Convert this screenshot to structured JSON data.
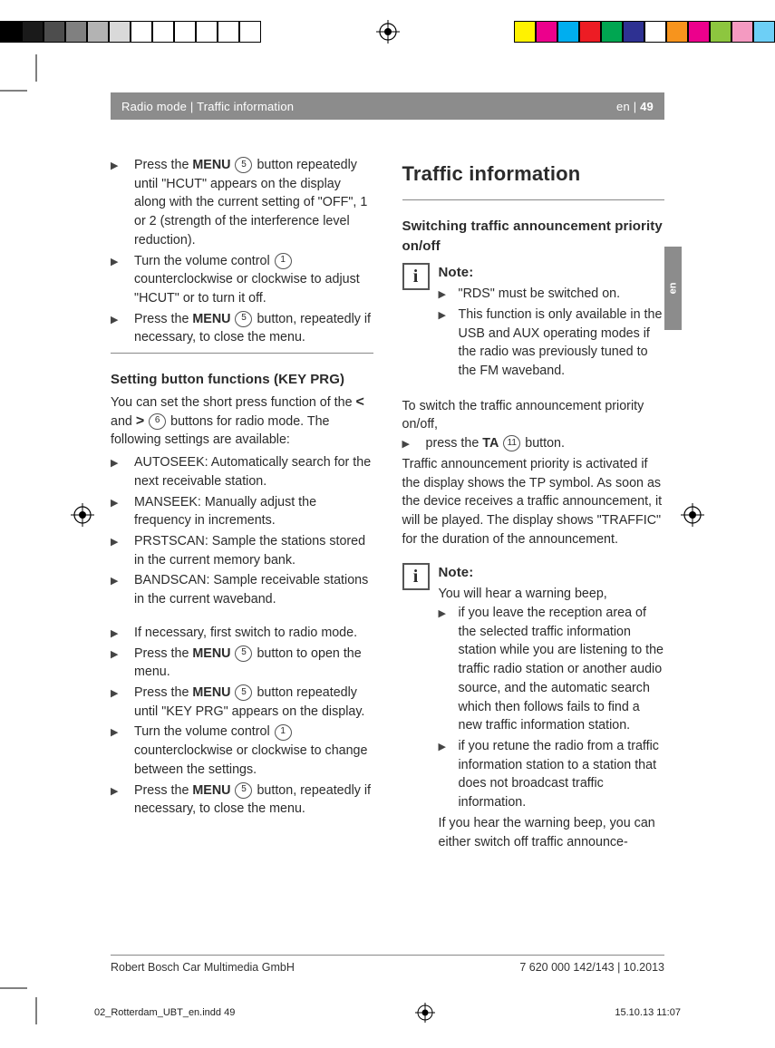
{
  "header": {
    "left": "Radio mode | Traffic information",
    "right_lang": "en",
    "right_page": "49"
  },
  "sidetab": "en",
  "left_col": {
    "top_list": [
      "Press the  <b>MENU</b> <n>5</n> button repeatedly until \"HCUT\" appears on the display along with the current setting of \"OFF\", 1 or 2 (strength of the interference level reduction).",
      "Turn the volume control <n>1</n> counterclock­wise or clockwise to adjust \"HCUT\" or to turn it off.",
      "Press the <b>MENU</b> <n>5</n> button, repeatedly if necessary, to close the menu."
    ],
    "subhead1_a": "Setting button functions (",
    "subhead1_b": "KEY PRG",
    "subhead1_c": ")",
    "para1_a": "You can set the short press function of the ",
    "para1_b": " and ",
    "para1_c": " ",
    "para1_num": "6",
    "para1_d": " buttons for radio mode. The following settings are available:",
    "settings_list": [
      "AUTOSEEK: Automatically search for the next receivable station.",
      "MANSEEK: Manually adjust the frequency in increments.",
      "PRSTSCAN: Sample the stations stored in the current memory bank.",
      "BANDSCAN: Sample receivable stations in the current waveband."
    ],
    "steps_list": [
      "If necessary, first switch to radio mode.",
      "Press the <b>MENU</b> <n>5</n> button to open the menu.",
      "Press the <b>MENU</b> <n>5</n> button repeatedly until \"KEY PRG\" appears on the display.",
      "Turn the volume control <n>1</n> counterclock­wise or clockwise to change between the settings.",
      "Press the <b>MENU</b> <n>5</n> button, repeatedly if necessary, to close the menu."
    ]
  },
  "right_col": {
    "h2": "Traffic information",
    "subhead1": "Switching traffic announcement priority on/off",
    "note1_label": "Note:",
    "note1_items": [
      "\"RDS\" must be switched on.",
      "This function is only available in the USB and AUX operating modes if the radio was previ­ously tuned to the FM waveband."
    ],
    "para1": "To switch the traffic announcement priority on/off,",
    "ta_step_a": "press the ",
    "ta_step_b": "TA",
    "ta_num": "11",
    "ta_step_c": " button.",
    "para2": "Traffic announcement priority is activated if the display shows the TP symbol. As soon as the device receives a traffic announcement, it will be played. The display shows \"TRAFFIC\" for the duration of the announcement.",
    "note2_label": "Note:",
    "note2_intro": "You will hear a warning beep,",
    "note2_items": [
      "if you leave the reception area of the selected traffic information station while you are listening to the traffic radio station or another audio source, and the automatic search which then follows fails to find a new traffic information station.",
      "if you retune the radio from a traffic information station to a station that does not broadcast traffic information."
    ],
    "note2_tail": "If you hear the warning beep, you can either switch off traffic announce-"
  },
  "footer": {
    "left": "Robert Bosch Car Multimedia GmbH",
    "right": "7 620 000 142/143 | 10.2013"
  },
  "prepress": {
    "file": "02_Rotterdam_UBT_en.indd   49",
    "stamp": "15.10.13   11:07"
  },
  "colorbar_left": [
    "#000",
    "#1a1a1a",
    "#4d4d4d",
    "#808080",
    "#b3b3b3",
    "#d9d9d9",
    "#fff",
    "#fff",
    "#fff",
    "#fff",
    "#fff",
    "#fff"
  ],
  "colorbar_right": [
    "#fff200",
    "#ec008c",
    "#00aeef",
    "#ed1c24",
    "#00a651",
    "#2e3192",
    "#fff",
    "#f7941d",
    "#ec008c",
    "#8dc63f",
    "#f49ac1",
    "#6dcff6"
  ]
}
